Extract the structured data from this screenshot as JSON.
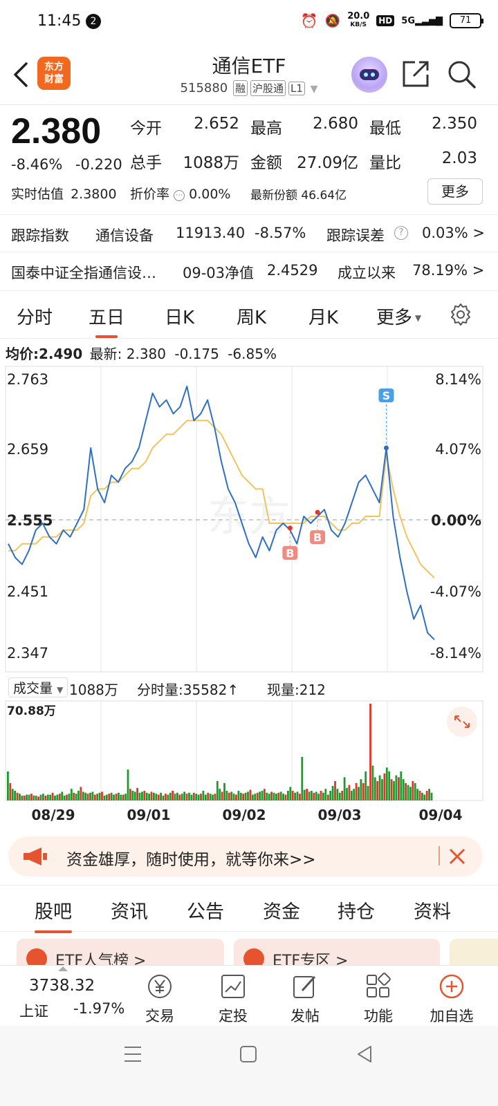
{
  "status_bar": {
    "time": "11:45",
    "notification_count": "2",
    "net_speed": "20.0",
    "net_unit": "KB/S",
    "hd": "HD",
    "signal": "5G",
    "battery": "71"
  },
  "header": {
    "logo_text_1": "东方",
    "logo_text_2": "财富",
    "title": "通信ETF",
    "code": "515880",
    "tag_margin": "融",
    "tag_hk": "沪股通",
    "tag_level": "L1"
  },
  "quote": {
    "price": "2.380",
    "change_pct": "-8.46%",
    "change": "-0.220",
    "open_label": "今开",
    "open": "2.652",
    "high_label": "最高",
    "high": "2.680",
    "low_label": "最低",
    "low": "2.350",
    "volume_label": "总手",
    "volume": "1088万",
    "amount_label": "金额",
    "amount": "27.09亿",
    "ratio_label": "量比",
    "ratio": "2.03",
    "est_label": "实时估值",
    "est": "2.3800",
    "premium_label": "折价率",
    "premium": "0.00%",
    "shares_label": "最新份额",
    "shares": "46.64亿",
    "more_label": "更多"
  },
  "tracking": {
    "label": "跟踪指数",
    "index_name": "通信设备",
    "index_value": "11913.40",
    "index_change": "-8.57%",
    "error_label": "跟踪误差",
    "error_value": "0.03% >"
  },
  "fund_row": {
    "name": "国泰中证全指通信设…",
    "nav_label": "09-03净值",
    "nav": "2.4529",
    "since_label": "成立以来",
    "since": "78.19% >"
  },
  "tabs": [
    "分时",
    "五日",
    "日K",
    "周K",
    "月K",
    "更多"
  ],
  "chart_info": {
    "avg_label": "均价:",
    "avg": "2.490",
    "latest_label": "最新:",
    "latest": "2.380",
    "diff": "-0.175",
    "diff_pct": "-6.85%"
  },
  "chart_data": {
    "type": "line",
    "y_ticks": [
      "2.763",
      "2.659",
      "2.555",
      "2.451",
      "2.347"
    ],
    "pct_ticks": [
      "8.14%",
      "4.07%",
      "0.00%",
      "-4.07%",
      "-8.14%"
    ],
    "ylim": [
      2.347,
      2.763
    ],
    "x_labels": [
      "08/29",
      "09/01",
      "09/02",
      "09/03",
      "09/04"
    ],
    "series": [
      {
        "values": [
          2.52,
          2.5,
          2.49,
          2.51,
          2.54,
          2.55,
          2.53,
          2.52,
          2.54,
          2.53,
          2.55,
          2.57,
          2.66,
          2.6,
          2.58,
          2.62,
          2.61,
          2.63,
          2.64,
          2.66,
          2.7,
          2.74,
          2.72,
          2.73,
          2.71,
          2.72,
          2.75,
          2.7,
          2.71,
          2.73,
          2.69,
          2.64,
          2.6,
          2.58,
          2.55,
          2.52,
          2.5,
          2.53,
          2.51,
          2.54,
          2.55,
          2.54,
          2.52,
          2.56,
          2.55,
          2.56,
          2.57,
          2.54,
          2.53,
          2.55,
          2.58,
          2.61,
          2.62,
          2.6,
          2.58,
          2.66,
          2.56,
          2.5,
          2.45,
          2.41,
          2.43,
          2.39,
          2.38
        ]
      },
      {
        "values": [
          2.51,
          2.51,
          2.52,
          2.52,
          2.52,
          2.53,
          2.53,
          2.53,
          2.54,
          2.54,
          2.54,
          2.55,
          2.59,
          2.6,
          2.6,
          2.61,
          2.61,
          2.62,
          2.63,
          2.63,
          2.64,
          2.66,
          2.67,
          2.68,
          2.68,
          2.69,
          2.7,
          2.7,
          2.7,
          2.7,
          2.69,
          2.68,
          2.66,
          2.64,
          2.62,
          2.61,
          2.6,
          2.6,
          2.55,
          2.55,
          2.55,
          2.55,
          2.55,
          2.55,
          2.56,
          2.56,
          2.56,
          2.55,
          2.54,
          2.54,
          2.55,
          2.55,
          2.56,
          2.56,
          2.56,
          2.65,
          2.6,
          2.56,
          2.53,
          2.51,
          2.49,
          2.48,
          2.47
        ]
      }
    ],
    "markers": [
      {
        "type": "B",
        "x_index": 41,
        "value": 2.543
      },
      {
        "type": "B",
        "x_index": 45,
        "value": 2.566
      },
      {
        "type": "S",
        "x_index": 55,
        "value": 2.66
      }
    ]
  },
  "volume": {
    "label": "成交量",
    "total": "1088万",
    "tick_label": "分时量:35582",
    "current_label": "现量:212",
    "max_label": "70.88万",
    "bars": [
      0.3,
      0.18,
      0.12,
      0.1,
      0.08,
      0.07,
      0.05,
      0.05,
      0.06,
      0.06,
      0.07,
      0.05,
      0.05,
      0.04,
      0.06,
      0.07,
      0.05,
      0.06,
      0.06,
      0.08,
      0.05,
      0.06,
      0.07,
      0.09,
      0.05,
      0.06,
      0.07,
      0.12,
      0.08,
      0.07,
      0.1,
      0.14,
      0.09,
      0.08,
      0.07,
      0.08,
      0.09,
      0.06,
      0.07,
      0.08,
      0.09,
      0.05,
      0.06,
      0.07,
      0.08,
      0.06,
      0.07,
      0.08,
      0.06,
      0.06,
      0.07,
      0.32,
      0.12,
      0.1,
      0.09,
      0.13,
      0.08,
      0.09,
      0.1,
      0.08,
      0.07,
      0.09,
      0.08,
      0.07,
      0.06,
      0.08,
      0.05,
      0.07,
      0.06,
      0.08,
      0.1,
      0.07,
      0.08,
      0.06,
      0.07,
      0.09,
      0.07,
      0.08,
      0.06,
      0.08,
      0.07,
      0.06,
      0.07,
      0.1,
      0.06,
      0.08,
      0.07,
      0.06,
      0.07,
      0.2,
      0.12,
      0.09,
      0.18,
      0.1,
      0.08,
      0.09,
      0.07,
      0.06,
      0.1,
      0.08,
      0.07,
      0.08,
      0.09,
      0.11,
      0.06,
      0.07,
      0.08,
      0.09,
      0.1,
      0.12,
      0.08,
      0.07,
      0.09,
      0.08,
      0.07,
      0.08,
      0.09,
      0.07,
      0.06,
      0.1,
      0.14,
      0.1,
      0.08,
      0.09,
      0.07,
      0.45,
      0.11,
      0.12,
      0.09,
      0.1,
      0.08,
      0.09,
      0.07,
      0.1,
      0.08,
      0.12,
      0.06,
      0.1,
      0.15,
      0.2,
      0.12,
      0.08,
      0.1,
      0.24,
      0.13,
      0.16,
      0.1,
      0.12,
      0.18,
      0.14,
      0.22,
      0.18,
      0.3,
      0.15,
      1.0,
      0.36,
      0.24,
      0.2,
      0.26,
      0.22,
      0.28,
      0.34,
      0.3,
      0.22,
      0.2,
      0.26,
      0.24,
      0.3,
      0.22,
      0.18,
      0.16,
      0.14,
      0.2,
      0.18,
      0.12,
      0.1,
      0.08,
      0.06,
      0.1,
      0.12,
      0.08
    ]
  },
  "banner": {
    "text": "资金雄厚，随时使用，就等你来>>"
  },
  "lower_tabs": [
    "股吧",
    "资讯",
    "公告",
    "资金",
    "持仓",
    "资料"
  ],
  "peek": {
    "card1": "ETF人气榜 >",
    "card2": "ETF专区 >"
  },
  "bottom_bar": {
    "index_value": "3738.32",
    "index_name": "上证",
    "index_change": "-1.97%",
    "trade": "交易",
    "dca": "定投",
    "post": "发帖",
    "func": "功能",
    "watch": "加自选"
  },
  "colors": {
    "accent": "#e5542e",
    "price_line": "#2e6fc6",
    "avg_line": "#f1c35b",
    "up": "#e6332a",
    "down": "#1d9a2c"
  }
}
